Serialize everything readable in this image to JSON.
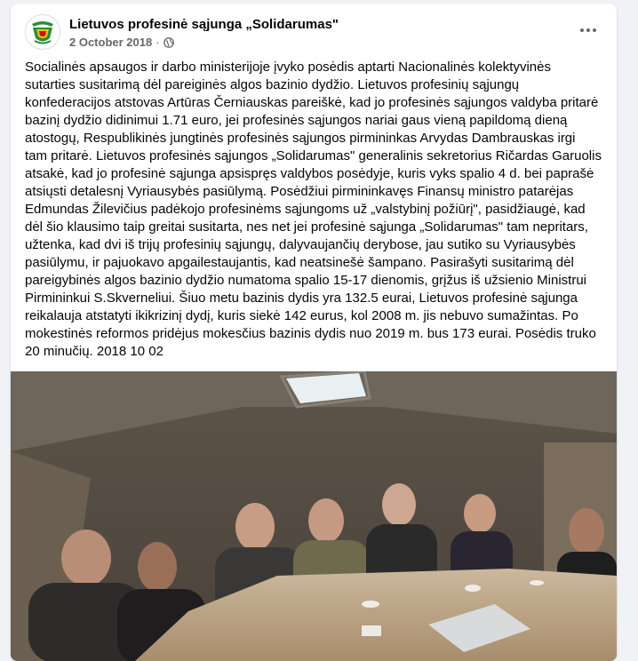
{
  "post": {
    "page_name": "Lietuvos profesinė sąjunga „Solidarumas\"",
    "date": "2 October 2018",
    "separator": "·",
    "privacy_icon": "globe-icon",
    "more_icon": "more-horizontal-icon",
    "text": "Socialinės apsaugos ir darbo ministerijoje įvyko posėdis aptarti Nacionalinės kolektyvinės\nsutarties susitarimą dėl pareiginės algos bazinio dydžio. Lietuvos profesinių sąjungų\nkonfederacijos atstovas Artūras Černiauskas pareiškė, kad jo profesinės sąjungos valdyba pritarė\nbazinį dydžio didinimui 1.71 euro, jei profesinės sąjungos nariai gaus vieną papildomą dieną\natostogų, Respublikinės jungtinės profesinės sąjungos pirmininkas Arvydas Dambrauskas irgi\ntam pritarė. Lietuvos profesinės sąjungos „Solidarumas\" generalinis sekretorius Ričardas Garuolis\natsakė, kad jo profesinė sąjunga apsispręs valdybos posėdyje, kuris vyks spalio 4 d. bei paprašė\natsiųsti detalesnį Vyriausybės pasiūlymą.  Posėdžiui pirmininkavęs Finansų ministro patarėjas\nEdmundas Žilevičius padėkojo profesinėms sąjungoms už „valstybinį požiūrį\", pasidžiaugė, kad\ndėl šio klausimo taip greitai susitarta, nes net jei profesinė sąjunga „Solidarumas\" tam nepritars,\nužtenka, kad dvi iš trijų profesinių sąjungų, dalyvaujančių derybose, jau sutiko su Vyriausybės\npasiūlymu, ir pajuokavo apgailestaujantis, kad neatsinešė šampano. Pasirašyti susitarimą dėl\npareigybinės algos bazinio dydžio numatoma  spalio 15-17 dienomis, grįžus iš užsienio Ministrui\nPirmininkui S.Skverneliui. Šiuo metu bazinis dydis yra 132.5 eurai, Lietuvos profesinė sąjunga\nreikalauja atstatyti ikikrizinį dydį, kuris siekė 142 eurus, kol 2008 m. jis nebuvo sumažintas. Po\nmokestinės reformos pridėjus mokesčius bazinis dydis nuo 2019 m. bus 173 eurai. Posėdis truko\n20 minučių. 2018 10 02"
  },
  "colors": {
    "background": "#f0f2f5",
    "card": "#ffffff",
    "text": "#050505",
    "secondary_text": "#65676b",
    "logo_green": "#2e8b3a",
    "logo_yellow": "#f2c200",
    "logo_red": "#c8102e"
  }
}
